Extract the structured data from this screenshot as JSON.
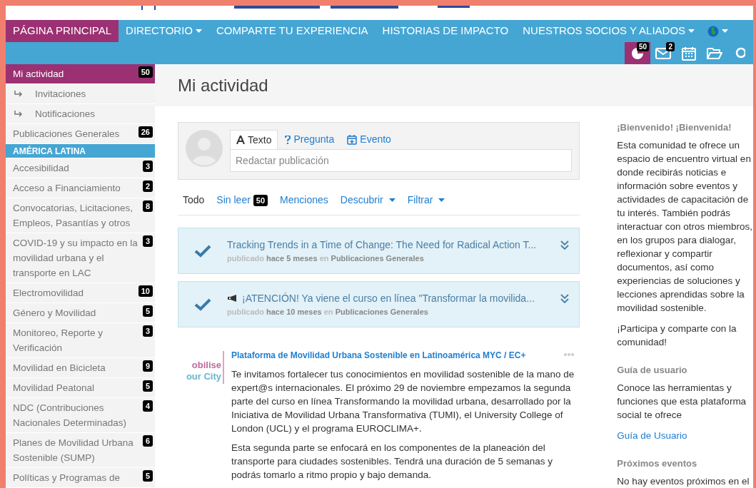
{
  "nav": {
    "items": [
      {
        "label": "PÁGINA PRINCIPAL",
        "selected": true,
        "dropdown": false
      },
      {
        "label": "DIRECTORIO",
        "selected": false,
        "dropdown": true
      },
      {
        "label": "COMPARTE TU EXPERIENCIA",
        "selected": false,
        "dropdown": false
      },
      {
        "label": "HISTORIAS DE IMPACTO",
        "selected": false,
        "dropdown": false
      },
      {
        "label": "NUESTROS SOCIOS Y ALIADOS",
        "selected": false,
        "dropdown": true
      }
    ],
    "language": {
      "dropdown": true
    }
  },
  "toolbar": [
    {
      "kind": "activity",
      "badge": "50",
      "selected": true
    },
    {
      "kind": "mail",
      "badge": "2",
      "selected": false
    },
    {
      "kind": "calendar",
      "selected": false
    },
    {
      "kind": "folder",
      "selected": false
    },
    {
      "kind": "search",
      "selected": false
    }
  ],
  "sidebar": [
    {
      "kind": "item",
      "label": "Mi actividad",
      "badge": "50",
      "selected": true
    },
    {
      "kind": "subitem",
      "label": "Invitaciones",
      "selected": false
    },
    {
      "kind": "subitem",
      "label": "Notificaciones",
      "selected": false
    },
    {
      "kind": "item",
      "label": "Publicaciones Generales",
      "badge": "26",
      "selected": false
    },
    {
      "kind": "section",
      "label": "AMÉRICA LATINA"
    },
    {
      "kind": "item",
      "label": "Accesibilidad",
      "badge": "3",
      "selected": false
    },
    {
      "kind": "item",
      "label": "Acceso a Financiamiento",
      "badge": "2",
      "selected": false
    },
    {
      "kind": "item",
      "label": "Convocatorias, Licitaciones, Empleos, Pasantías y otros",
      "badge": "8",
      "selected": false
    },
    {
      "kind": "item",
      "label": "COVID-19 y su impacto en la movilidad urbana y el transporte en LAC",
      "badge": "3",
      "selected": false
    },
    {
      "kind": "item",
      "label": "Electromovilidad",
      "badge": "10",
      "selected": false
    },
    {
      "kind": "item",
      "label": "Género y Movilidad",
      "badge": "5",
      "selected": false
    },
    {
      "kind": "item",
      "label": "Monitoreo, Reporte y Verificación",
      "badge": "3",
      "selected": false
    },
    {
      "kind": "item",
      "label": "Movilidad en Bicicleta",
      "badge": "9",
      "selected": false
    },
    {
      "kind": "item",
      "label": "Movilidad Peatonal",
      "badge": "5",
      "selected": false
    },
    {
      "kind": "item",
      "label": "NDC (Contribuciones Nacionales Determinadas)",
      "badge": "4",
      "selected": false
    },
    {
      "kind": "item",
      "label": "Planes de Movilidad Urbana Sostenible (SUMP)",
      "badge": "6",
      "selected": false
    },
    {
      "kind": "item",
      "label": "Políticas y Programas de",
      "badge": "5",
      "selected": false
    }
  ],
  "page_title": "Mi actividad",
  "composer": {
    "tabs": [
      {
        "kind": "text",
        "label": "Texto",
        "selected": true
      },
      {
        "kind": "question",
        "label": "Pregunta",
        "selected": false
      },
      {
        "kind": "event",
        "label": "Evento",
        "selected": false
      }
    ],
    "placeholder": "Redactar publicación"
  },
  "filters": [
    {
      "label": "Todo",
      "selected": true,
      "dropdown": false
    },
    {
      "label": "Sin leer",
      "badge": "50",
      "selected": false,
      "dropdown": false
    },
    {
      "label": "Menciones",
      "selected": false,
      "dropdown": false
    },
    {
      "label": "Descubrir",
      "selected": false,
      "dropdown": true
    },
    {
      "label": "Filtrar",
      "selected": false,
      "dropdown": true
    }
  ],
  "notices": [
    {
      "kind": "plain",
      "title": "Tracking Trends in a Time of Change: The Need for Radical Action T...",
      "posted": "publicado",
      "time": "hace 5 meses",
      "in": "en",
      "group": "Publicaciones Generales"
    },
    {
      "kind": "announcement",
      "title": "¡ATENCIÓN! Ya viene el curso en línea \"Transformar la movilida...",
      "posted": "publicado",
      "time": "hace 10 meses",
      "in": "en",
      "group": "Publicaciones Generales"
    }
  ],
  "post": {
    "logo_lines": [
      "obilise",
      "our City"
    ],
    "author": "Plataforma de Movilidad Urbana Sostenible en Latinoamérica MYC / EC+",
    "paragraphs": [
      "Te invitamos fortalecer tus conocimientos en movilidad sostenible de la mano de expert@s internacionales. El próximo 29 de noviembre empezamos la segunda parte del curso en línea Transformando la movilidad urbana, desarrollado por la Iniciativa de Movilidad Urbana Transformativa (TUMI), el University College of London (UCL) y el programa EUROCLIMA+.",
      "Esta segunda parte se enfocará en los componentes de la planeación del transporte para ciudades sostenibles. Tendrá una duración de 5 semanas y podrás tomarlo a ritmo propio y bajo demanda."
    ]
  },
  "aside": [
    {
      "heading": "¡Bienvenido! ¡Bienvenida!",
      "paragraphs": [
        "Esta comunidad te ofrece un espacio de encuentro virtual en donde recibirás noticias e información sobre eventos y actividades de capacitación de tu interés. También podrás interactuar con otros miembros, en los grupos para dialogar, reflexionar y compartir documentos, así como experiencias de soluciones y lecciones aprendidas sobre la movilidad sostenible.",
        "¡Participa y comparte con la comunidad!"
      ]
    },
    {
      "heading": "Guía de usuario",
      "paragraphs": [
        "Conoce las herramientas y funciones que esta plataforma social te ofrece"
      ],
      "link": "Guía de Usuario"
    },
    {
      "heading": "Próximos eventos",
      "paragraphs": [
        "No hay eventos próximos en el"
      ]
    }
  ]
}
